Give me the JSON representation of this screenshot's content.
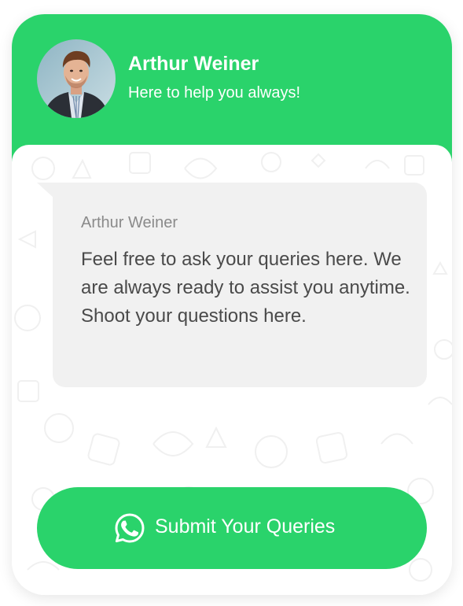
{
  "header": {
    "name": "Arthur Weiner",
    "subtitle": "Here to help you always!"
  },
  "message": {
    "sender": "Arthur Weiner",
    "text": "Feel free to ask your queries here. We are always ready to assist you anytime. Shoot your questions here."
  },
  "cta": {
    "label": "Submit Your Queries",
    "icon": "whatsapp-icon"
  },
  "colors": {
    "brand_green": "#2ad36b",
    "bubble_bg": "#f1f1f1",
    "sender_text": "#8a8a8a",
    "message_text": "#4a4a4a"
  }
}
